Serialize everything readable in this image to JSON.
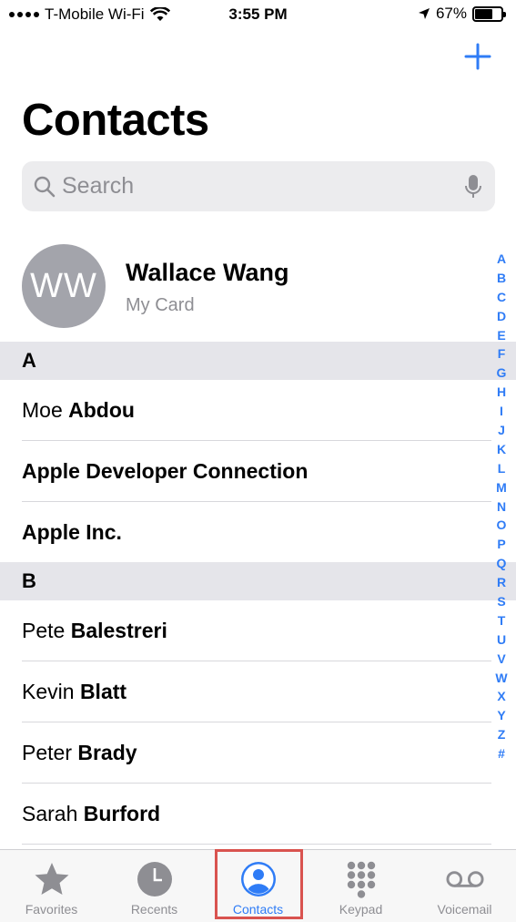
{
  "status_bar": {
    "carrier": "T-Mobile Wi-Fi",
    "time": "3:55 PM",
    "battery": "67%",
    "battery_level": 0.67
  },
  "header": {
    "title": "Contacts",
    "add_icon": "plus-icon"
  },
  "search": {
    "placeholder": "Search"
  },
  "my_card": {
    "initials": "WW",
    "name": "Wallace Wang",
    "subtitle": "My Card"
  },
  "sections": [
    {
      "letter": "A",
      "contacts": [
        {
          "first": "Moe",
          "last": "Abdou"
        },
        {
          "first": "",
          "last": "Apple Developer Connection"
        },
        {
          "first": "",
          "last": "Apple Inc."
        }
      ]
    },
    {
      "letter": "B",
      "contacts": [
        {
          "first": "Pete",
          "last": "Balestreri"
        },
        {
          "first": "Kevin",
          "last": "Blatt"
        },
        {
          "first": "Peter",
          "last": "Brady"
        },
        {
          "first": "Sarah",
          "last": "Burford"
        }
      ]
    }
  ],
  "index_letters": [
    "A",
    "B",
    "C",
    "D",
    "E",
    "F",
    "G",
    "H",
    "I",
    "J",
    "K",
    "L",
    "M",
    "N",
    "O",
    "P",
    "Q",
    "R",
    "S",
    "T",
    "U",
    "V",
    "W",
    "X",
    "Y",
    "Z",
    "#"
  ],
  "tabs": [
    {
      "label": "Favorites",
      "icon": "star-icon"
    },
    {
      "label": "Recents",
      "icon": "clock-icon"
    },
    {
      "label": "Contacts",
      "icon": "person-icon",
      "active": true
    },
    {
      "label": "Keypad",
      "icon": "keypad-icon"
    },
    {
      "label": "Voicemail",
      "icon": "voicemail-icon"
    }
  ],
  "colors": {
    "accent": "#2f7cf6",
    "inactive": "#8e8e93",
    "highlight_box": "#d9534f"
  }
}
